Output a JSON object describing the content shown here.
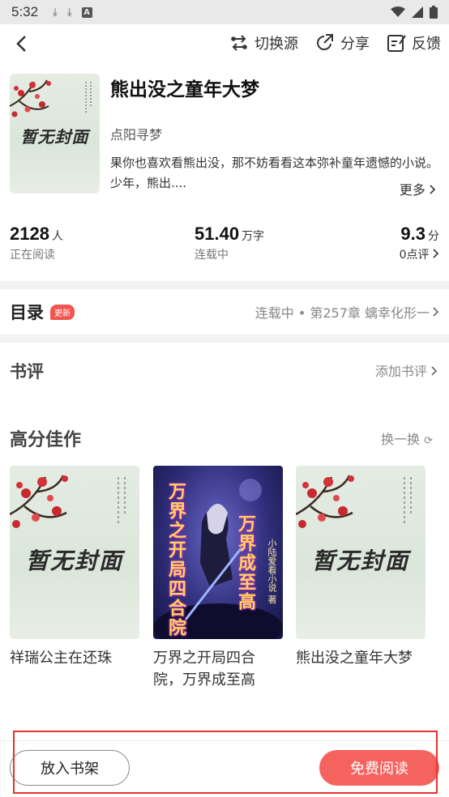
{
  "status_bar": {
    "time": "5:32"
  },
  "toolbar": {
    "switch_source_label": "切换源",
    "share_label": "分享",
    "feedback_label": "反馈"
  },
  "book": {
    "cover_text": "暂无封面",
    "title": "熊出没之童年大梦",
    "author": "点阳寻梦",
    "description": "果你也喜欢看熊出没，那不妨看看这本弥补童年遗憾的小说。少年，熊出....",
    "more_label": "更多"
  },
  "stats": {
    "readers": {
      "value": "2128",
      "unit": "人",
      "label": "正在阅读"
    },
    "words": {
      "value": "51.40",
      "unit": "万字",
      "label": "连载中"
    },
    "rating": {
      "value": "9.3",
      "unit": "分",
      "label": "0点评"
    }
  },
  "toc": {
    "heading": "目录",
    "badge": "更新",
    "latest": "连载中 • 第257章 螭幸化形一"
  },
  "review": {
    "heading": "书评",
    "add_label": "添加书评"
  },
  "recommend": {
    "heading": "高分佳作",
    "swap_label": "换一换",
    "items": [
      {
        "name": "祥瑞公主在还珠",
        "cover_text": "暂无封面"
      },
      {
        "name": "万界之开局四合院，万界成至高",
        "cover_title_a": "万界之开局四合院",
        "cover_title_b": "万界成至高",
        "cover_author": "小陆爱看小说 著"
      },
      {
        "name": "熊出没之童年大梦",
        "cover_text": "暂无封面"
      }
    ]
  },
  "bottom": {
    "shelf_label": "放入书架",
    "read_label": "免费阅读"
  }
}
